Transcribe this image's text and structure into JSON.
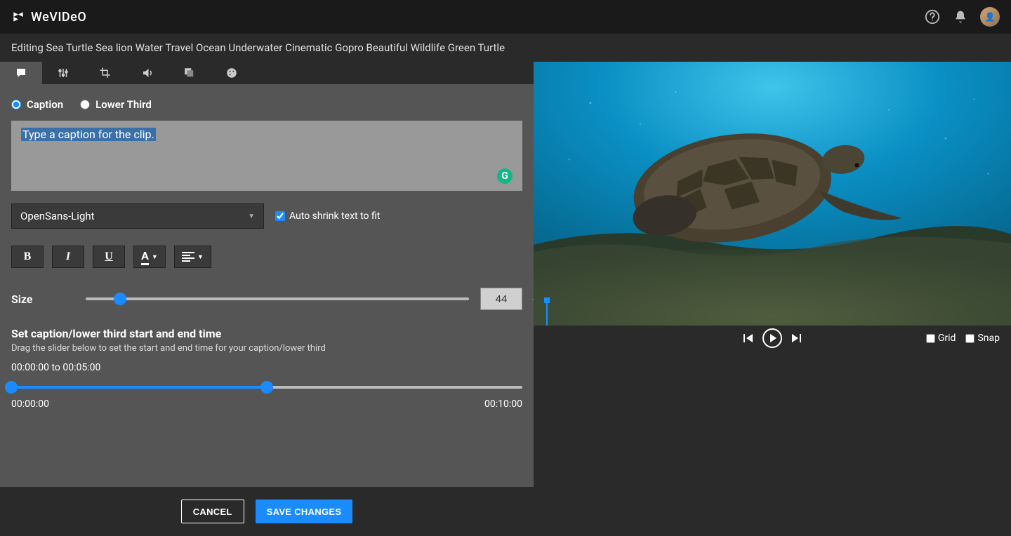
{
  "brand": {
    "name": "WeVIDeO"
  },
  "project_title": "Editing Sea Turtle Sea lion Water Travel Ocean Underwater Cinematic Gopro Beautiful Wildlife Green Turtle",
  "caption_mode": {
    "caption_label": "Caption",
    "lower_third_label": "Lower Third",
    "selected": "caption"
  },
  "caption": {
    "placeholder": "Type a caption for the clip."
  },
  "font": {
    "selected": "OpenSans-Light",
    "auto_shrink_label": "Auto shrink text to fit",
    "auto_shrink": true
  },
  "format_buttons": {
    "bold": "B",
    "italic": "I",
    "underline": "U",
    "color": "A",
    "align": "≡"
  },
  "size": {
    "label": "Size",
    "value": "44",
    "percent": 9
  },
  "timing": {
    "heading": "Set caption/lower third start and end time",
    "hint": "Drag the slider below to set the start and end time for your caption/lower third",
    "start": "00:00:00",
    "end": "00:05:00",
    "range_text": "00:00:00 to 00:05:00",
    "min_label": "00:00:00",
    "max_label": "00:10:00",
    "start_percent": 0,
    "end_percent": 50
  },
  "footer": {
    "cancel": "CANCEL",
    "save": "SAVE CHANGES"
  },
  "preview": {
    "grid_label": "Grid",
    "snap_label": "Snap",
    "grid": false,
    "snap": false
  }
}
